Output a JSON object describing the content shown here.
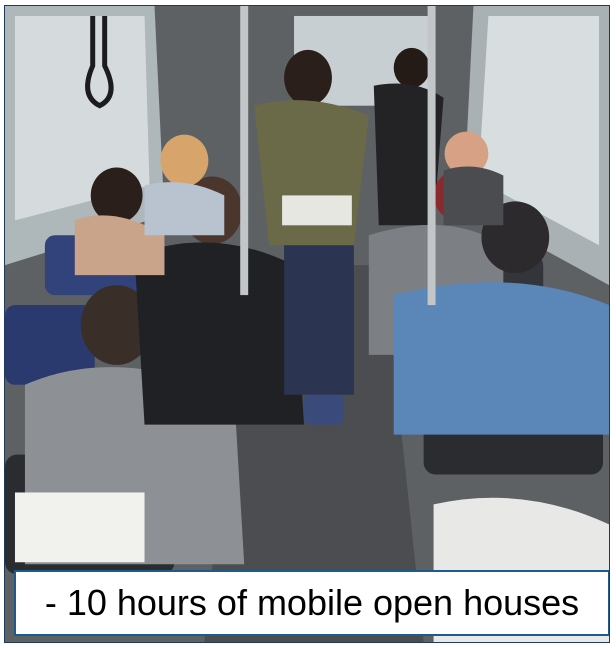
{
  "caption": {
    "text": "- 10 hours of mobile open houses"
  },
  "photo": {
    "scene": "bus-interior",
    "colors": {
      "ceiling": "#6b6f72",
      "windows": "#cfd6d9",
      "floor": "#55575a",
      "seat_blue": "#2f3f77",
      "pole": "#b8bcbf"
    }
  }
}
